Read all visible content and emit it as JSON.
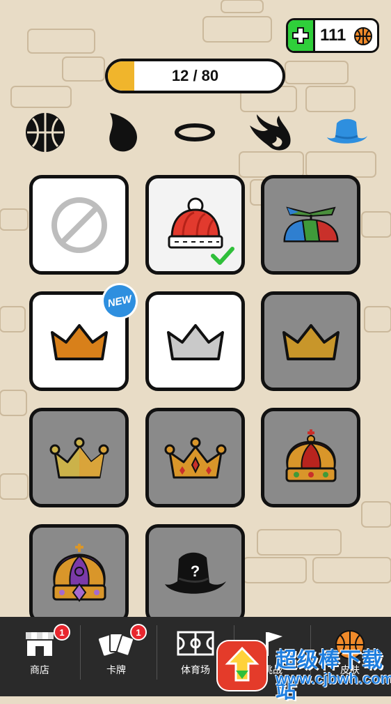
{
  "header": {
    "coins": "111",
    "progress": {
      "text": "12 / 80",
      "value": 12,
      "max": 80
    }
  },
  "categories": [
    {
      "name": "ball",
      "active": false
    },
    {
      "name": "trail",
      "active": false
    },
    {
      "name": "hoop",
      "active": false
    },
    {
      "name": "fire",
      "active": false
    },
    {
      "name": "hat",
      "active": true
    }
  ],
  "items": [
    {
      "name": "none",
      "state": "owned"
    },
    {
      "name": "red-beanie",
      "state": "selected"
    },
    {
      "name": "propeller-cap",
      "state": "locked"
    },
    {
      "name": "bronze-crown",
      "state": "owned",
      "badge": "NEW"
    },
    {
      "name": "silver-crown",
      "state": "owned"
    },
    {
      "name": "gold-crown",
      "state": "locked"
    },
    {
      "name": "gold-pointed-crown",
      "state": "locked"
    },
    {
      "name": "jeweled-gold-crown",
      "state": "locked"
    },
    {
      "name": "royal-red-crown",
      "state": "locked"
    },
    {
      "name": "imperial-purple-crown",
      "state": "locked"
    },
    {
      "name": "mystery-hat",
      "state": "locked",
      "mark": "?"
    }
  ],
  "nav": [
    {
      "label": "商店",
      "badge": "1"
    },
    {
      "label": "卡牌",
      "badge": "1"
    },
    {
      "label": "体育场"
    },
    {
      "label": "挑战"
    },
    {
      "label": "皮肤"
    }
  ],
  "watermark": {
    "title": "超级棒下载站",
    "url": "www.cjbwh.com"
  },
  "colors": {
    "progress_fill": "#f0b52c",
    "accent": "#2e8fdf",
    "plus_green": "#2fcf3a",
    "badge_red": "#e8262e"
  }
}
